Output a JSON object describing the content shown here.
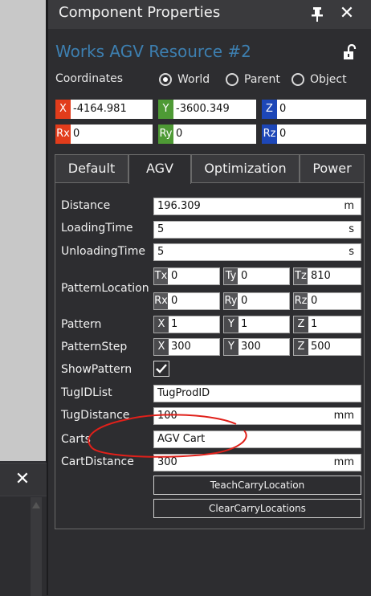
{
  "panel": {
    "title": "Component Properties",
    "component_name": "Works AGV Resource #2",
    "coordinates": {
      "label": "Coordinates",
      "options": [
        "World",
        "Parent",
        "Object"
      ],
      "selected": "World"
    },
    "position": {
      "x_tag": "X",
      "x": "-4164.981",
      "y_tag": "Y",
      "y": "-3600.349",
      "z_tag": "Z",
      "z": "0"
    },
    "rotation": {
      "rx_tag": "Rx",
      "rx": "0",
      "ry_tag": "Ry",
      "ry": "0",
      "rz_tag": "Rz",
      "rz": "0"
    },
    "tabs": [
      "Default",
      "AGV",
      "Optimization",
      "Power"
    ],
    "active_tab": "AGV"
  },
  "agv": {
    "distance": {
      "label": "Distance",
      "value": "196.309",
      "unit": "m"
    },
    "loading_time": {
      "label": "LoadingTime",
      "value": "5",
      "unit": "s"
    },
    "unloading_time": {
      "label": "UnloadingTime",
      "value": "5",
      "unit": "s"
    },
    "pattern_location": {
      "label": "PatternLocation",
      "tx": "0",
      "ty": "0",
      "tz": "810",
      "rx": "0",
      "ry": "0",
      "rz": "0",
      "tags": {
        "tx": "Tx",
        "ty": "Ty",
        "tz": "Tz",
        "rx": "Rx",
        "ry": "Ry",
        "rz": "Rz"
      }
    },
    "pattern": {
      "label": "Pattern",
      "x": "1",
      "y": "1",
      "z": "1"
    },
    "pattern_step": {
      "label": "PatternStep",
      "x": "300",
      "y": "300",
      "z": "500"
    },
    "xyz_tags": {
      "x": "X",
      "y": "Y",
      "z": "Z"
    },
    "show_pattern": {
      "label": "ShowPattern",
      "checked": true
    },
    "tug_id_list": {
      "label": "TugIDList",
      "value": "TugProdID"
    },
    "tug_distance": {
      "label": "TugDistance",
      "value": "100",
      "unit": "mm"
    },
    "carts": {
      "label": "Carts",
      "value": "AGV Cart"
    },
    "cart_distance": {
      "label": "CartDistance",
      "value": "300",
      "unit": "mm"
    },
    "teach_button": "TeachCarryLocation",
    "clear_button": "ClearCarryLocations"
  },
  "colors": {
    "accent_name": "#3d7fb0",
    "x_tag": "#e23c1b",
    "y_tag": "#4e9a35",
    "z_tag": "#1d47b8",
    "annotation": "#e0201a"
  }
}
